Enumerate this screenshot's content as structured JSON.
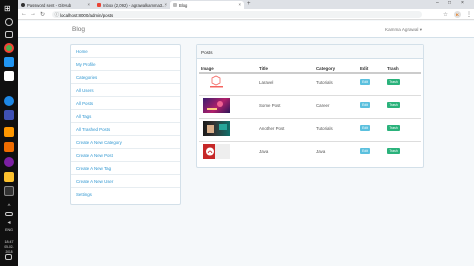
{
  "browser": {
    "tabs": [
      {
        "title": "Password sent - GitHub",
        "favicon_color": "#333333"
      },
      {
        "title": "Inbox (2,092) - agrawalkamma3...",
        "favicon_color": "#ea4335"
      },
      {
        "title": "Blog",
        "favicon_color": "#bbbbbb"
      }
    ],
    "url": "localhost:8000/admin/posts",
    "user_initial": "K"
  },
  "app": {
    "brand": "Blog",
    "user_menu": "Kamma Agrawal ▾"
  },
  "sidebar": {
    "items": [
      {
        "label": "Home"
      },
      {
        "label": "My Profile"
      },
      {
        "label": "Categories"
      },
      {
        "label": "All Users"
      },
      {
        "label": "All Posts"
      },
      {
        "label": "All Tags"
      },
      {
        "label": "All Trashed Posts"
      },
      {
        "label": "Create A New Category"
      },
      {
        "label": "Create A New Post"
      },
      {
        "label": "Create A New Tag"
      },
      {
        "label": "Create A New User"
      },
      {
        "label": "Settings"
      }
    ]
  },
  "posts": {
    "heading": "Posts",
    "columns": [
      "Image",
      "Title",
      "Category",
      "Edit",
      "Trash"
    ],
    "rows": [
      {
        "title": "Laravel",
        "category": "Tutorials",
        "edit": "Edit",
        "trash": "Trash",
        "thumb": "laravel"
      },
      {
        "title": "Some Post",
        "category": "Career",
        "edit": "Edit",
        "trash": "Trash",
        "thumb": "purple"
      },
      {
        "title": "Another Post",
        "category": "Tutorials",
        "edit": "Edit",
        "trash": "Trash",
        "thumb": "teal"
      },
      {
        "title": "Java",
        "category": "Java",
        "edit": "Edit",
        "trash": "Trash",
        "thumb": "java"
      }
    ]
  },
  "taskbar": {
    "lang": "ENG",
    "time": "18:47",
    "date": "05-02-2018"
  }
}
